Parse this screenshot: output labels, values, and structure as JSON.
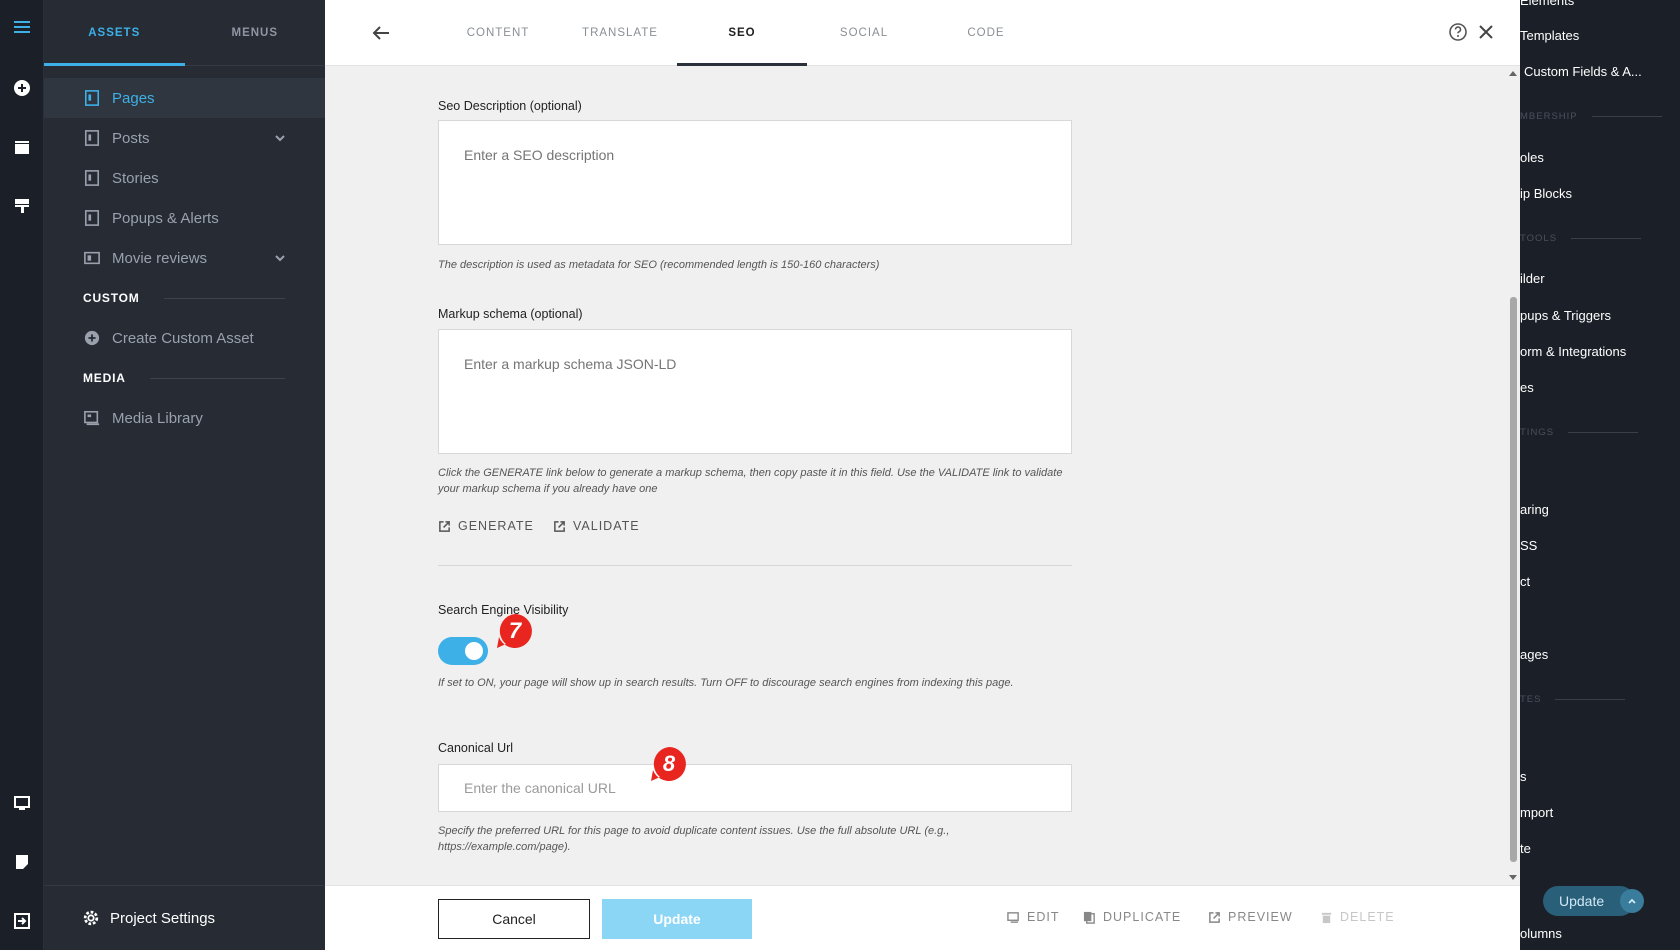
{
  "sidebar": {
    "tabs": [
      {
        "label": "ASSETS",
        "active": true
      },
      {
        "label": "MENUS",
        "active": false
      }
    ],
    "items": [
      {
        "label": "Pages",
        "icon": "page-icon",
        "active": true
      },
      {
        "label": "Posts",
        "icon": "page-icon",
        "has_submenu": true
      },
      {
        "label": "Stories",
        "icon": "page-icon"
      },
      {
        "label": "Popups & Alerts",
        "icon": "page-icon"
      },
      {
        "label": "Movie reviews",
        "icon": "collection-icon",
        "has_submenu": true
      }
    ],
    "custom_section": "CUSTOM",
    "create_custom": "Create Custom Asset",
    "media_section": "MEDIA",
    "media_library": "Media Library",
    "project_settings": "Project Settings"
  },
  "panel": {
    "tabs": [
      {
        "label": "CONTENT",
        "active": false
      },
      {
        "label": "TRANSLATE",
        "active": false
      },
      {
        "label": "SEO",
        "active": true
      },
      {
        "label": "SOCIAL",
        "active": false
      },
      {
        "label": "CODE",
        "active": false
      }
    ],
    "seo_description": {
      "label": "Seo Description (optional)",
      "placeholder": "Enter a SEO description",
      "hint": "The description is used as metadata for SEO (recommended length is 150-160 characters)"
    },
    "markup_schema": {
      "label": "Markup schema (optional)",
      "placeholder": "Enter a markup schema JSON-LD",
      "hint": "Click the GENERATE link below to generate a markup schema, then copy paste it in this field. Use the VALIDATE link to validate your markup schema if you already have one",
      "generate": "GENERATE",
      "validate": "VALIDATE"
    },
    "visibility": {
      "label": "Search Engine Visibility",
      "enabled": true,
      "hint": "If set to ON, your page will show up in search results. Turn OFF to discourage search engines from indexing this page."
    },
    "canonical": {
      "label": "Canonical Url",
      "placeholder": "Enter the canonical URL",
      "hint": "Specify the preferred URL for this page to avoid duplicate content issues. Use the full absolute URL (e.g., https://example.com/page)."
    },
    "markers": [
      "7",
      "8"
    ],
    "marker_color": "#e8261f",
    "footer": {
      "cancel": "Cancel",
      "update": "Update",
      "edit": "EDIT",
      "duplicate": "DUPLICATE",
      "preview": "PREVIEW",
      "delete": "DELETE"
    }
  },
  "bg_sidebar": {
    "items": [
      "Elements",
      "Templates",
      "Custom Fields & A...",
      "oles",
      "ip Blocks",
      "ilder",
      "pups & Triggers",
      "orm & Integrations",
      "es",
      "aring",
      "SS",
      "ct",
      "ages",
      "s",
      "mport",
      "te",
      "olumns"
    ],
    "sections": [
      "MBERSHIP",
      "TOOLS",
      "TINGS",
      "TES"
    ],
    "update": "Update"
  },
  "colors": {
    "accent": "#3db0e8",
    "update_button": "#8cd6f5",
    "sidebar_bg": "#262b34",
    "rail_bg": "#1b1f27"
  }
}
